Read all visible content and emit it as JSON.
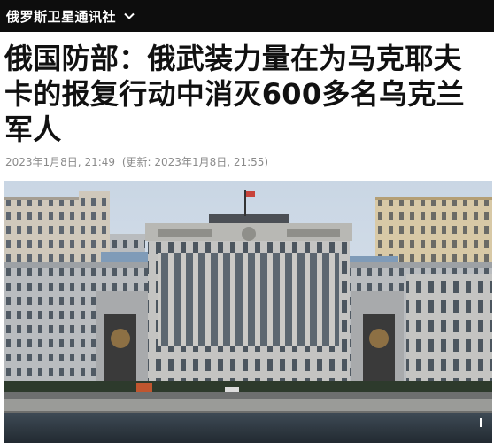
{
  "header": {
    "site_name": "俄罗斯卫星通讯社",
    "menu_icon": "chevron-down-icon",
    "background": "#0d0d0d"
  },
  "article": {
    "title": "俄国防部：俄武装力量在为马克耶夫卡的报复行动中消灭600多名乌克兰军人",
    "published": "2023年1月8日, 21:49",
    "updated": "(更新: 2023年1月8日, 21:55)",
    "image_subject": "building-photo"
  }
}
